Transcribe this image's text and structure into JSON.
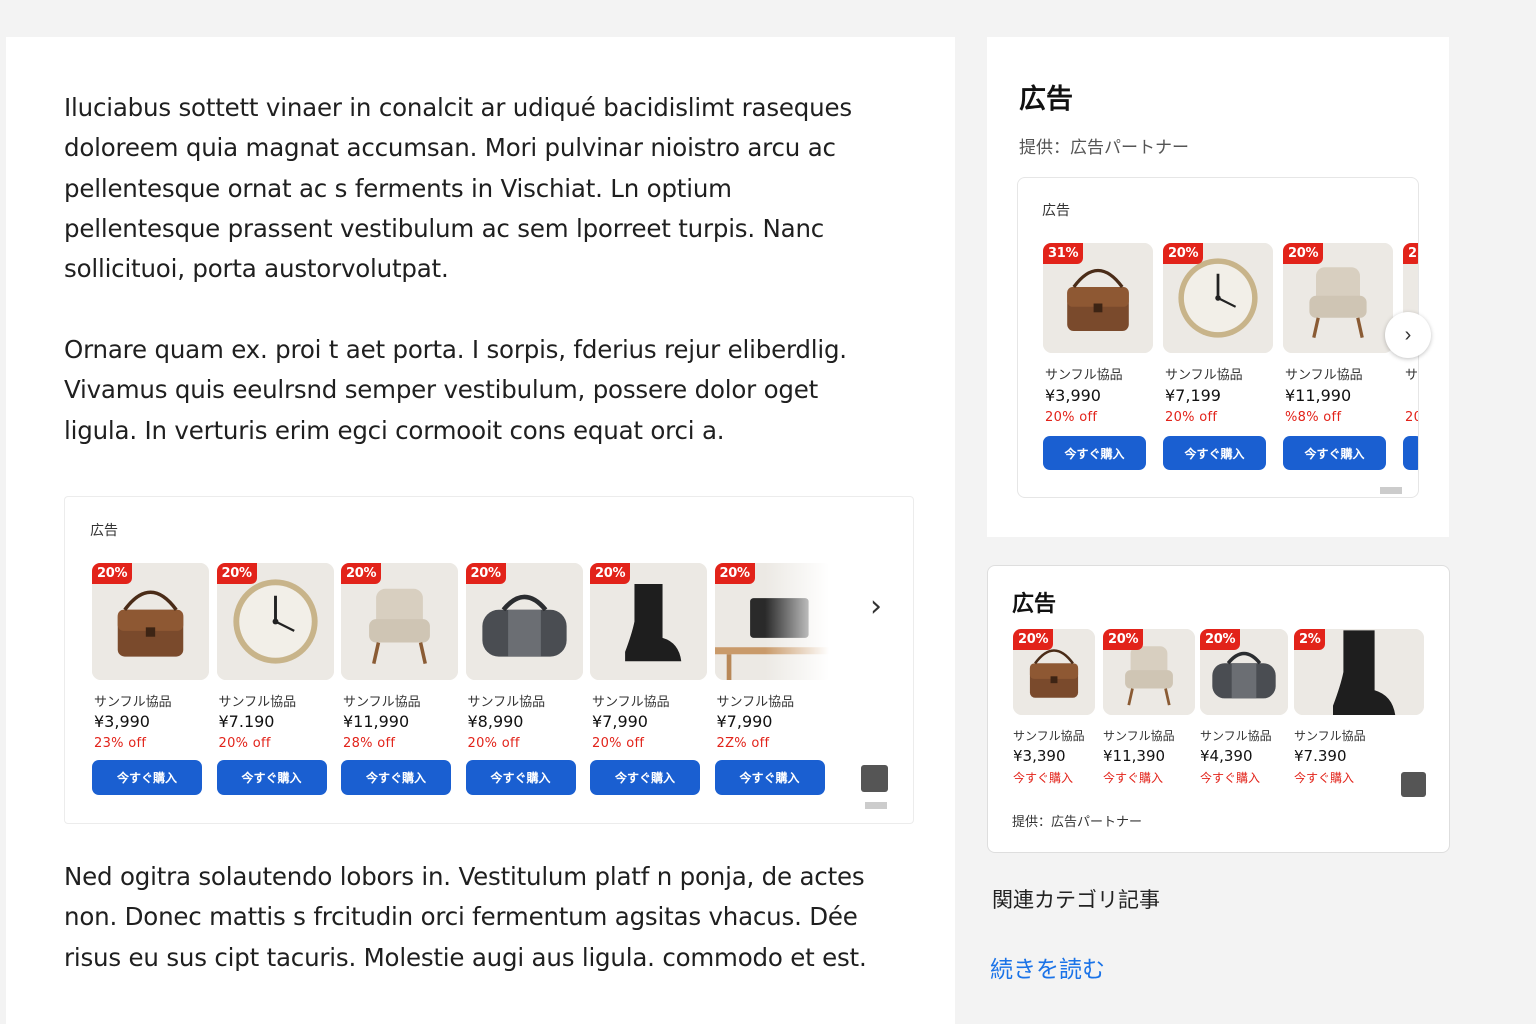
{
  "article": {
    "paragraphs": [
      "Iluciabus sottett vinaer in  conalcit ar udiqué bacidislimt raseques doloreem quia magnat accumsan. Mori pulvinar nioistro arcu ac pellentesque ornat ac s ferments in Vischiat.  Ln optium pellentesque prassent vestibulum ac sem lporreet turpis. Nanc sollicituoi‚ porta austorvolutpat.",
      "Ornare quam ex. proi t aet  porta. I sorpis, fderius rejur eliberdlig. Vivamus quis eeulrsnd semper vestibulum, possere dolor oget ligula. In verturis erim egci cormooit  cons equat orci a.",
      "Ned ogitra solautendo lobors in. Vestitulum platf n ponja, de actes non. Donec mattis s frcitudin orci  fermentum agsitas vhacus. Dée risus eu sus cipt tacuris. Molestie augi aus ligula. commodo et est."
    ]
  },
  "inline_ad": {
    "label": "広告",
    "products": [
      {
        "badge": "20%",
        "name": "サンフル協品",
        "price": "¥3,990",
        "discount": "23% off",
        "buy": "今すぐ購入",
        "icon": "bag"
      },
      {
        "badge": "20%",
        "name": "サンフル協品",
        "price": "¥7.190",
        "discount": "20% off",
        "buy": "今すぐ購入",
        "icon": "clock"
      },
      {
        "badge": "20%",
        "name": "サンフル協品",
        "price": "¥11,990",
        "discount": "28% off",
        "buy": "今すぐ購入",
        "icon": "chair"
      },
      {
        "badge": "20%",
        "name": "サンフル協品",
        "price": "¥8,990",
        "discount": "20% off",
        "buy": "今すぐ購入",
        "icon": "duffel"
      },
      {
        "badge": "20%",
        "name": "サンフル協品",
        "price": "¥7,990",
        "discount": "20% off",
        "buy": "今すぐ購入",
        "icon": "boot"
      },
      {
        "badge": "20%",
        "name": "サンフル協品",
        "price": "¥7,990",
        "discount": "2Z% off",
        "buy": "今すぐ購入",
        "icon": "lamp"
      }
    ]
  },
  "sidebar": {
    "title": "広告",
    "provider": "提供：広告パートナー",
    "box_label": "広告",
    "products": [
      {
        "badge": "31%",
        "name": "サンフル協品",
        "price": "¥3,990",
        "discount": "20% off",
        "buy": "今すぐ購入",
        "icon": "bag"
      },
      {
        "badge": "20%",
        "name": "サンフル協品",
        "price": "¥7,199",
        "discount": "20% off",
        "buy": "今すぐ購入",
        "icon": "clock"
      },
      {
        "badge": "20%",
        "name": "サンフル協品",
        "price": "¥11,990",
        "discount": "%8% off",
        "buy": "今すぐ購入",
        "icon": "chair"
      },
      {
        "badge": "2",
        "name": "サ",
        "price": "",
        "discount": "20",
        "buy": "",
        "icon": "blank"
      }
    ]
  },
  "sidebar2": {
    "title": "広告",
    "products": [
      {
        "badge": "20%",
        "name": "サンフル協品",
        "price": "¥3,390",
        "buy": "今すぐ購入",
        "icon": "bag"
      },
      {
        "badge": "20%",
        "name": "サンフル協品",
        "price": "¥11,390",
        "buy": "今すぐ購入",
        "icon": "chair"
      },
      {
        "badge": "20%",
        "name": "サンフル協品",
        "price": "¥4,390",
        "buy": "今すぐ購入",
        "icon": "duffel"
      },
      {
        "badge": "2%",
        "name": "サンフル協品",
        "price": "¥7.390",
        "buy": "今すぐ購入",
        "icon": "boot"
      }
    ],
    "provider": "提供：広告パートナー"
  },
  "related": "関連カテゴリ記事",
  "readmore": "続きを読む",
  "colors": {
    "accent": "#1a5fd1",
    "sale": "#e2231a",
    "link": "#1a73e8"
  }
}
